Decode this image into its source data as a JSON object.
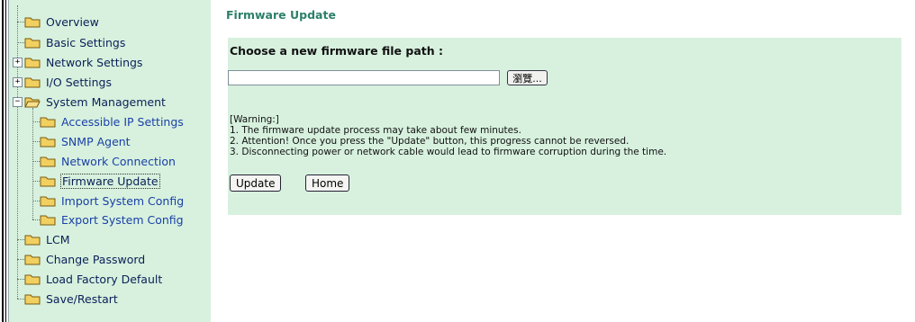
{
  "sidebar": {
    "items": [
      {
        "label": "Overview"
      },
      {
        "label": "Basic Settings"
      },
      {
        "label": "Network Settings"
      },
      {
        "label": "I/O Settings"
      },
      {
        "label": "System Management"
      },
      {
        "label": "Accessible IP Settings"
      },
      {
        "label": "SNMP Agent"
      },
      {
        "label": "Network Connection"
      },
      {
        "label": "Firmware Update"
      },
      {
        "label": "Import System Config"
      },
      {
        "label": "Export System Config"
      },
      {
        "label": "LCM"
      },
      {
        "label": "Change Password"
      },
      {
        "label": "Load Factory Default"
      },
      {
        "label": "Save/Restart"
      }
    ],
    "expand_plus": "+",
    "expand_minus": "−"
  },
  "main": {
    "title": "Firmware Update",
    "choose_label": "Choose a new firmware file path :",
    "path_input": {
      "value": "",
      "placeholder": ""
    },
    "browse_label": "瀏覽...",
    "warning": {
      "heading": "[Warning:]",
      "lines": [
        "1. The firmware update process may take about few minutes.",
        "2. Attention! Once you press the \"Update\" button, this progress cannot be reversed.",
        "3. Disconnecting power or network cable would lead to firmware corruption during the time."
      ]
    },
    "update_label": "Update",
    "home_label": "Home"
  },
  "colors": {
    "panel_bg": "#d7f1de",
    "title_green": "#2c7f6a",
    "link_blue": "#1b40a8",
    "nav_dark": "#0b1f57"
  }
}
